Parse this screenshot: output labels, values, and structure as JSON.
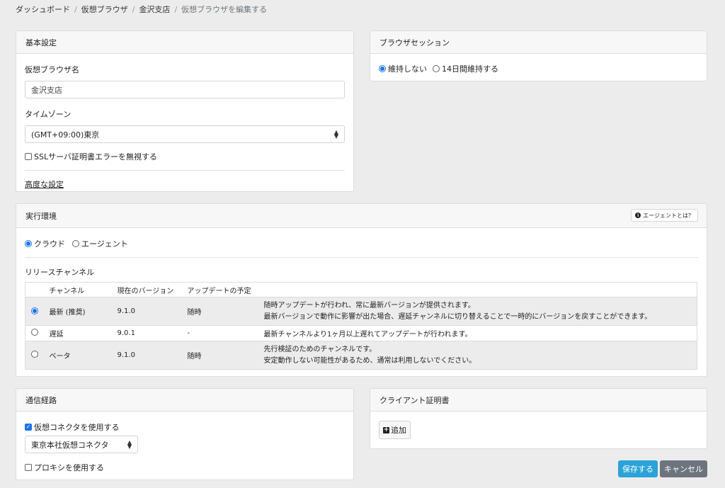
{
  "breadcrumb": [
    "ダッシュボード",
    "仮想ブラウザ",
    "金沢支店",
    "仮想ブラウザを編集する"
  ],
  "basic": {
    "title": "基本設定",
    "name_label": "仮想ブラウザ名",
    "name_value": "金沢支店",
    "timezone_label": "タイムゾーン",
    "timezone_value": "(GMT+09:00)東京",
    "ssl_label": "SSLサーバ証明書エラーを無視する",
    "advanced_link": "高度な設定"
  },
  "session": {
    "title": "ブラウザセッション",
    "options": [
      "維持しない",
      "14日間維持する"
    ]
  },
  "env": {
    "title": "実行環境",
    "agent_help": "エージェントとは？",
    "options": [
      "クラウド",
      "エージェント"
    ],
    "release_label": "リリースチャンネル",
    "headers": [
      "チャンネル",
      "現在のバージョン",
      "アップデートの予定"
    ],
    "rows": [
      {
        "channel": "最新 (推奨)",
        "version": "9.1.0",
        "schedule": "随時",
        "desc1": "随時アップデートが行われ、常に最新バージョンが提供されます。",
        "desc2": "最新バージョンで動作に影響が出た場合、遅延チャンネルに切り替えることで一時的にバージョンを戻すことができます。"
      },
      {
        "channel": "遅延",
        "version": "9.0.1",
        "schedule": "-",
        "desc1": "最新チャンネルより1ヶ月以上遅れてアップデートが行われます。",
        "desc2": ""
      },
      {
        "channel": "ベータ",
        "version": "9.1.0",
        "schedule": "随時",
        "desc1": "先行検証のためのチャンネルです。",
        "desc2": "安定動作しない可能性があるため、通常は利用しないでください。"
      }
    ]
  },
  "route": {
    "title": "通信経路",
    "connector_label": "仮想コネクタを使用する",
    "connector_value": "東京本社仮想コネクタ",
    "proxy_label": "プロキシを使用する"
  },
  "cert": {
    "title": "クライアント証明書",
    "add_label": "追加"
  },
  "actions": {
    "save": "保存する",
    "cancel": "キャンセル"
  },
  "colors": {
    "primary": "#1a73e8",
    "save_bg": "#2aa3d8",
    "cancel_bg": "#6c757d"
  }
}
